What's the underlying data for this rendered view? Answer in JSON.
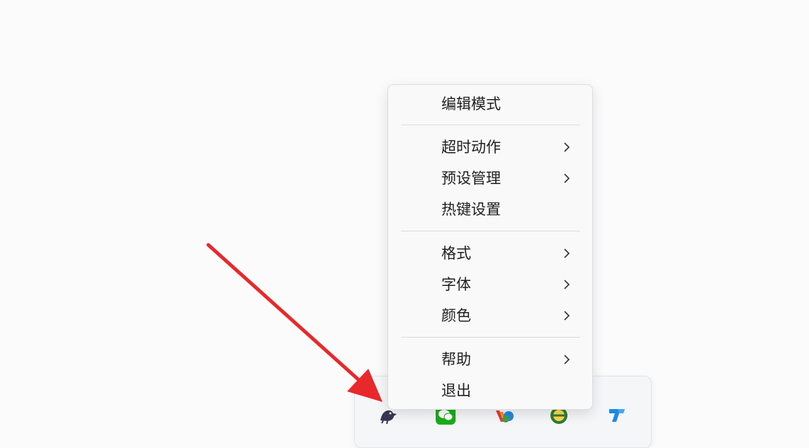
{
  "context_menu": {
    "items": [
      {
        "label": "编辑模式",
        "submenu": false
      },
      {
        "label": "超时动作",
        "submenu": true
      },
      {
        "label": "预设管理",
        "submenu": true
      },
      {
        "label": "热键设置",
        "submenu": false
      },
      {
        "label": "格式",
        "submenu": true
      },
      {
        "label": "字体",
        "submenu": true
      },
      {
        "label": "颜色",
        "submenu": true
      },
      {
        "label": "帮助",
        "submenu": true
      },
      {
        "label": "退出",
        "submenu": false
      }
    ]
  },
  "tray": {
    "icons": [
      "bird-app-icon",
      "wechat-icon",
      "colorful-app-icon",
      "green-circle-app-icon",
      "blue-t-app-icon"
    ]
  },
  "colors": {
    "annotation_arrow": "#e8292b",
    "wechat": "#1aad19",
    "tray_blue": "#1e88e5"
  }
}
